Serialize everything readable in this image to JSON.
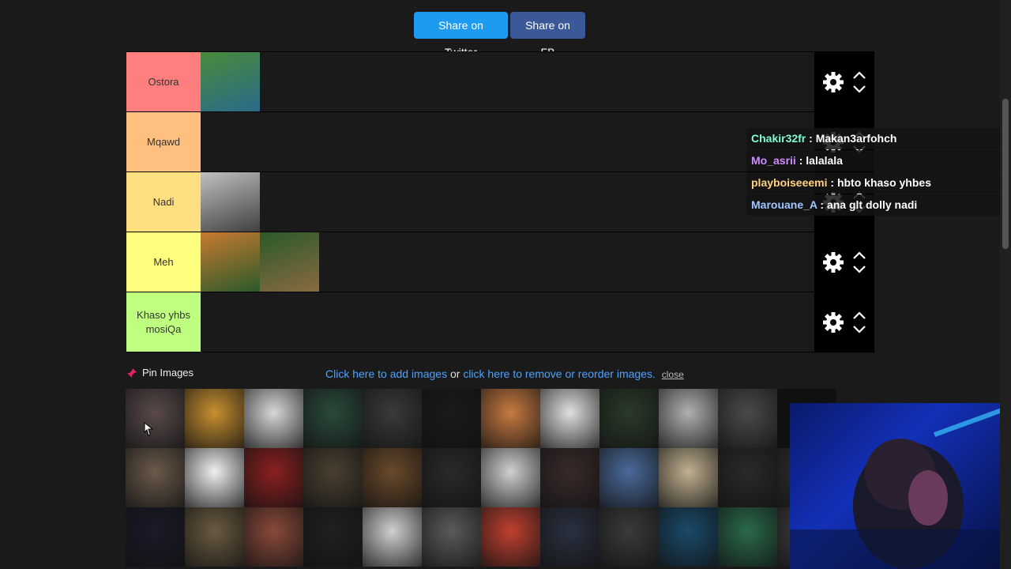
{
  "share": {
    "twitter_label": "Share on Twitter",
    "fb_label": "Share on FB"
  },
  "colors": {
    "twitter": "#1d9bf0",
    "facebook": "#3b5998",
    "link": "#4aa3ff"
  },
  "tiers": [
    {
      "label": "Ostora",
      "color": "#ff7f7f",
      "items": 1
    },
    {
      "label": "Mqawd",
      "color": "#ffbf7f",
      "items": 0
    },
    {
      "label": "Nadi",
      "color": "#ffdf7f",
      "items": 1
    },
    {
      "label": "Meh",
      "color": "#ffff7f",
      "items": 2
    },
    {
      "label": "Khaso yhbs mosiQa",
      "color": "#bfff7f",
      "items": 0
    }
  ],
  "chat": [
    {
      "user": "Chakir32fr",
      "message": "Makan3arfohch",
      "color": "#7fffd4"
    },
    {
      "user": "Mo_asrii",
      "message": "lalalala",
      "color": "#d08cff"
    },
    {
      "user": "playboiseeemi",
      "message": "hbto khaso yhbes",
      "color": "#ffd27f"
    },
    {
      "user": "Marouane_A",
      "message": "ana glt dolly nadi",
      "color": "#a0c8ff"
    }
  ],
  "pin": {
    "label": "Pin Images",
    "icon": "pin-icon"
  },
  "add_images": {
    "link1": "Click here to add images",
    "or_text": "or",
    "link2": "click here to remove or reorder images.",
    "close": "close"
  },
  "icons": {
    "settings": "gear-icon",
    "move_up": "chevron-up-icon",
    "move_down": "chevron-down-icon"
  },
  "pool_count": 36
}
